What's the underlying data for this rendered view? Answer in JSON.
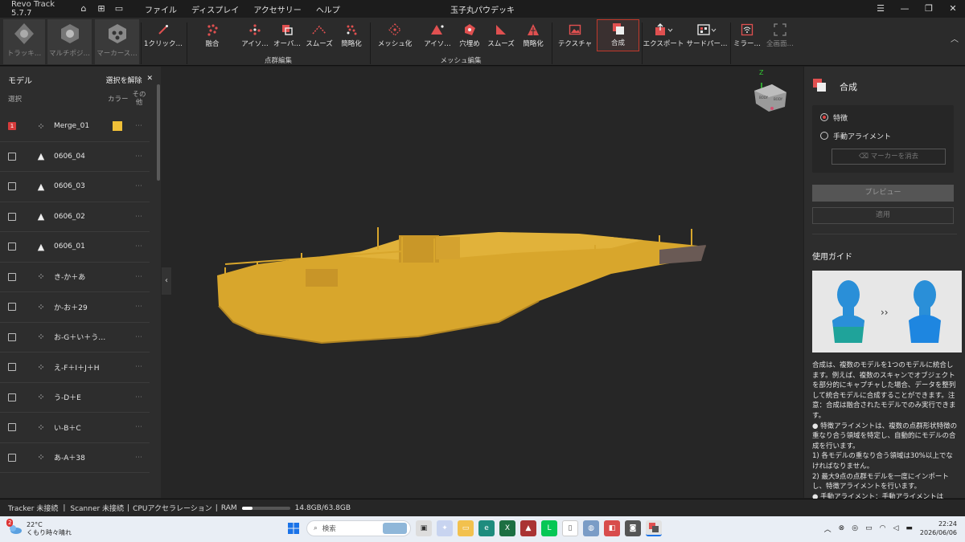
{
  "titlebar": {
    "app_name": "Revo Track 5.7.7",
    "menu": [
      "ファイル",
      "ディスプレイ",
      "アクセサリー",
      "ヘルプ"
    ],
    "doc_title": "玉子丸パウデッキ"
  },
  "toolbar": {
    "tracking": "トラッキ…",
    "multi": "マルチポジ…",
    "marker": "マーカース…",
    "one_click": "1クリック…",
    "fusion": "融合",
    "pc_isolate": "アイソ…",
    "pc_overlap": "オーバ…",
    "pc_smooth": "スムーズ",
    "pc_simplify": "簡略化",
    "pc_group": "点群編集",
    "meshify": "メッシュ化",
    "mesh_isolate": "アイソ…",
    "mesh_fill": "穴埋め",
    "mesh_smooth": "スムーズ",
    "mesh_simplify": "簡略化",
    "mesh_group": "メッシュ編集",
    "texture": "テクスチャ",
    "merge": "合成",
    "export": "エクスポート",
    "thirdparty": "サードパー…",
    "mirror": "ミラー…",
    "fullscreen": "全画面…"
  },
  "left_panel": {
    "title": "モデル",
    "deselect": "選択を解除",
    "col_select": "選択",
    "col_color": "カラー",
    "col_other": "その他",
    "models": [
      {
        "name": "Merge_01",
        "type": "pointcloud",
        "checked": true,
        "num": "1",
        "color": "#f0c038"
      },
      {
        "name": "0606_04",
        "type": "mesh",
        "checked": false
      },
      {
        "name": "0606_03",
        "type": "mesh",
        "checked": false
      },
      {
        "name": "0606_02",
        "type": "mesh",
        "checked": false
      },
      {
        "name": "0606_01",
        "type": "mesh",
        "checked": false
      },
      {
        "name": "き-か＋あ",
        "type": "pointcloud",
        "checked": false
      },
      {
        "name": "か-お＋29",
        "type": "pointcloud",
        "checked": false
      },
      {
        "name": "お-G＋い＋う…",
        "type": "pointcloud",
        "checked": false
      },
      {
        "name": "え-F＋I＋J＋H",
        "type": "pointcloud",
        "checked": false
      },
      {
        "name": "う-D＋E",
        "type": "pointcloud",
        "checked": false
      },
      {
        "name": "い-B＋C",
        "type": "pointcloud",
        "checked": false
      },
      {
        "name": "あ-A＋38",
        "type": "pointcloud",
        "checked": false
      }
    ]
  },
  "viewport": {
    "axis_label": "Z",
    "model_color": "#d8a62c"
  },
  "right_panel": {
    "title": "合成",
    "option1": "特徴",
    "option2": "手動アライメント",
    "clear_markers": "マーカーを消去",
    "preview": "プレビュー",
    "apply": "適用",
    "guide_title": "使用ガイド",
    "guide_text": [
      "合成は、複数のモデルを1つのモデルに統合します。例えば、複数のスキャンでオブジェクトを部分的にキャプチャした場合、データを整列して統合モデルに合成することができます。注意：合成は融合されたモデルでのみ実行できます。",
      "● 特徴アライメントは、複数の点群形状特徴の重なり合う領域を特定し、自動的にモデルの合成を行います。",
      "1) 各モデルの重なり合う領域は30%以上でなければなりません。",
      "2) 最大9点の点群モデルを一度にインポートし、特徴アライメントを行います。",
      "● 手動アライメント：手動アライメントは"
    ]
  },
  "status": {
    "tracker": "Tracker 未接続",
    "scanner": "Scanner 未接続",
    "cpu": "CPUアクセラレーション",
    "ram_label": "RAM",
    "ram_value": "14.8GB/63.8GB",
    "ram_fraction": 0.23
  },
  "taskbar": {
    "weather_badge": "2",
    "temp": "22°C",
    "weather": "くもり時々晴れ",
    "search": "検索",
    "time": "22:24",
    "date": "2026/06/06"
  }
}
